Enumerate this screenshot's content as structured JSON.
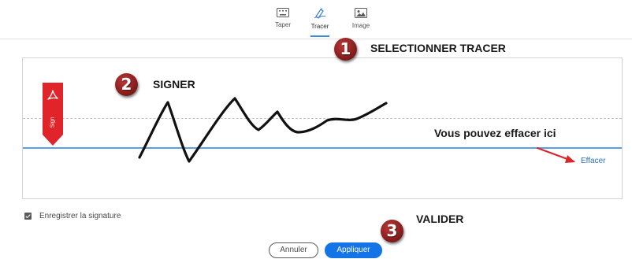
{
  "tabs": [
    {
      "label": "Taper",
      "icon": "keyboard-icon",
      "active": false
    },
    {
      "label": "Tracer",
      "icon": "pen-icon",
      "active": true
    },
    {
      "label": "Image",
      "icon": "image-icon",
      "active": false
    }
  ],
  "callouts": {
    "step1": {
      "number": "1",
      "text": "SELECTIONNER TRACER"
    },
    "step2": {
      "number": "2",
      "text": "SIGNER"
    },
    "step3": {
      "number": "3",
      "text": "VALIDER"
    },
    "erase_note": "Vous pouvez effacer ici"
  },
  "signature_area": {
    "flag_label": "Sign",
    "flag_icon": "acrobat-logo-icon",
    "clear_label": "Effacer"
  },
  "save_signature": {
    "label": "Enregistrer la signature",
    "checked": true
  },
  "footer": {
    "cancel_label": "Annuler",
    "apply_label": "Appliquer"
  },
  "colors": {
    "accent": "#1473e6",
    "baseline": "#5b9ee8",
    "flag": "#e0242a",
    "callout_badge": "#8c1f1f",
    "arrow": "#d9262c"
  }
}
